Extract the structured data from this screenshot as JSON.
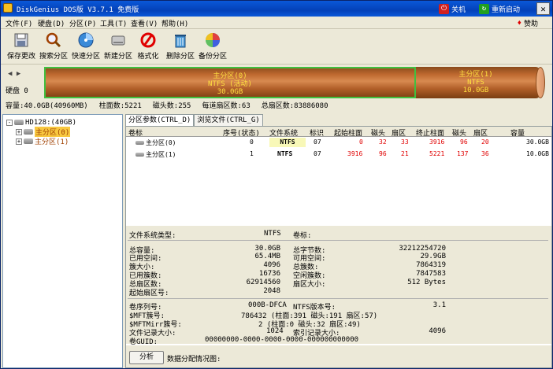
{
  "window": {
    "title": "DiskGenius DOS版 V3.7.1 免费版",
    "shutdown": "关机",
    "restart": "重新启动",
    "close": "✕"
  },
  "menu": {
    "items": [
      "文件(F)",
      "硬盘(D)",
      "分区(P)",
      "工具(T)",
      "查看(V)",
      "帮助(H)"
    ],
    "donate": "赞助"
  },
  "toolbar": {
    "items": [
      {
        "label": "保存更改",
        "icon": "save-icon"
      },
      {
        "label": "搜索分区",
        "icon": "search-icon"
      },
      {
        "label": "快速分区",
        "icon": "quick-partition-icon"
      },
      {
        "label": "新建分区",
        "icon": "new-partition-icon"
      },
      {
        "label": "格式化",
        "icon": "format-icon"
      },
      {
        "label": "删除分区",
        "icon": "delete-partition-icon"
      },
      {
        "label": "备份分区",
        "icon": "backup-partition-icon"
      }
    ]
  },
  "disk_map": {
    "disk_label": "硬盘 0",
    "partitions": [
      {
        "name": "主分区(0)",
        "fs": "NTFS (活动)",
        "size": "30.0GB"
      },
      {
        "name": "主分区(1)",
        "fs": "NTFS",
        "size": "10.0GB"
      }
    ]
  },
  "disk_info": [
    "容量:40.0GB(40960MB)",
    "柱面数:5221",
    "磁头数:255",
    "每道扇区数:63",
    "总扇区数:83886080"
  ],
  "tree": {
    "disk": "HD128:(40GB)",
    "partitions": [
      "主分区(0)",
      "主分区(1)"
    ],
    "expand": "+",
    "collapse": "-"
  },
  "tabs": [
    "分区参数(CTRL_D)",
    "浏览文件(CTRL_G)"
  ],
  "table": {
    "headers": [
      "卷标",
      "序号(状态)",
      "文件系统",
      "标识",
      "起始柱面",
      "磁头",
      "扇区",
      "终止柱面",
      "磁头",
      "扇区",
      "容量"
    ],
    "rows": [
      [
        "主分区(0)",
        "0",
        "NTFS",
        "07",
        "0",
        "32",
        "33",
        "3916",
        "96",
        "20",
        "30.0GB"
      ],
      [
        "主分区(1)",
        "1",
        "NTFS",
        "07",
        "3916",
        "96",
        "21",
        "5221",
        "137",
        "36",
        "10.0GB"
      ]
    ]
  },
  "details": {
    "fs_type_label": "文件系统类型:",
    "fs_type": "NTFS",
    "volume_label": "卷标:",
    "left": [
      {
        "k": "总容量:",
        "v": "30.0GB"
      },
      {
        "k": "已用空间:",
        "v": "65.4MB"
      },
      {
        "k": "簇大小:",
        "v": "4096"
      },
      {
        "k": "已用簇数:",
        "v": "16736"
      },
      {
        "k": "总扇区数:",
        "v": "62914560"
      },
      {
        "k": "起始扇区号:",
        "v": "2048"
      }
    ],
    "right": [
      {
        "k": "总字节数:",
        "v": "32212254720"
      },
      {
        "k": "可用空间:",
        "v": "29.9GB"
      },
      {
        "k": "总簇数:",
        "v": "7864319"
      },
      {
        "k": "空闲簇数:",
        "v": "7847583"
      },
      {
        "k": "扇区大小:",
        "v": "512 Bytes"
      }
    ],
    "serial_label": "卷序列号:",
    "serial": "000B-DFCA",
    "ntfs_ver_label": "NTFS版本号:",
    "ntfs_ver": "3.1",
    "mft_label": "$MFT簇号:",
    "mft": "786432 (柱面:391 磁头:191 扇区:57)",
    "mftmirr_label": "$MFTMirr簇号:",
    "mftmirr": "2 (柱面:0 磁头:32 扇区:49)",
    "frs_label": "文件记录大小:",
    "frs": "1024",
    "index_label": "索引记录大小:",
    "index": "4096",
    "guid_label": "卷GUID:",
    "guid": "00000000-0000-0000-0000-000000000000"
  },
  "bottom": {
    "analyze": "分析",
    "map_label": "数据分配情况图:"
  },
  "colors": {
    "titlebar": "#0441b8",
    "partition_fill": "#c06a30",
    "partition_border": "#40c040",
    "partition_text": "#ffe040",
    "fs_highlight": "#f8f8b8"
  }
}
